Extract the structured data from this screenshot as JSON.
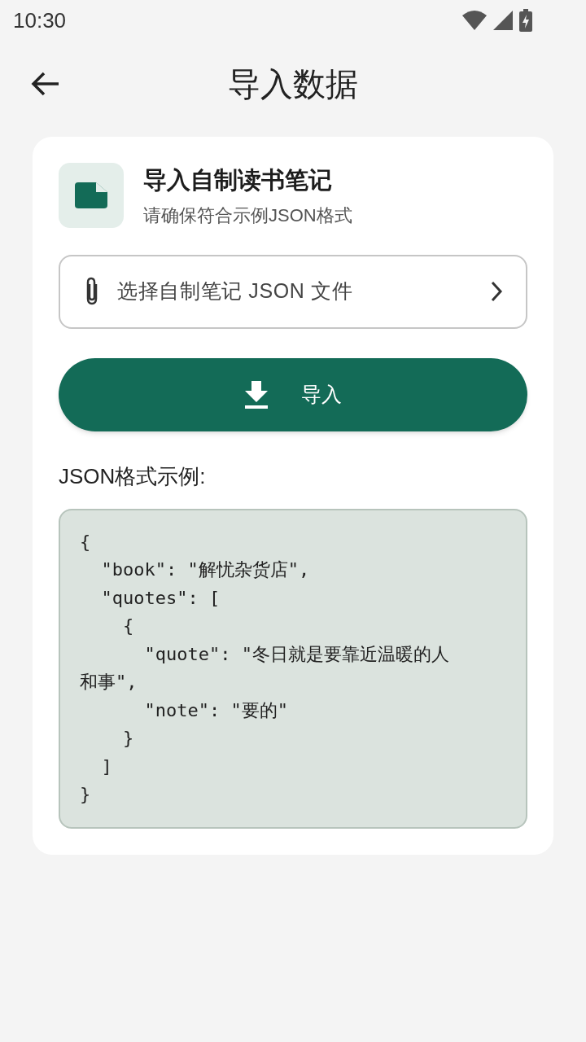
{
  "status_bar": {
    "time": "10:30"
  },
  "header": {
    "title": "导入数据"
  },
  "card": {
    "title": "导入自制读书笔记",
    "subtitle": "请确保符合示例JSON格式",
    "file_picker": {
      "placeholder": "选择自制笔记 JSON 文件"
    },
    "import_button": {
      "label": "导入"
    },
    "example_label": "JSON格式示例:",
    "code_lines": [
      "{",
      "  \"book\": \"解忧杂货店\",",
      "  \"quotes\": [",
      "    {",
      "      \"quote\": \"冬日就是要靠近温暖的人",
      "和事\",",
      "      \"note\": \"要的\"",
      "    }",
      "  ]",
      "}"
    ]
  }
}
